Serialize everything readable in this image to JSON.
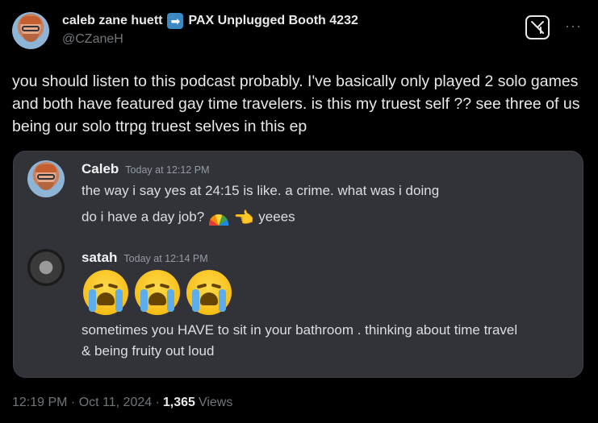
{
  "author": {
    "display_name": "caleb zane huett",
    "arrow_icon": "right-arrow-emoji",
    "status": "PAX Unplugged Booth 4232",
    "handle": "@CZaneH"
  },
  "more_label": "···",
  "tweet": {
    "text": "you should listen to this podcast probably. I've basically only played 2 solo games and both have featured gay time travelers. is this my truest self ?? see three of us being our solo ttrpg truest selves in this ep"
  },
  "embed": {
    "messages": [
      {
        "name": "Caleb",
        "time": "Today at 12:12 PM",
        "lines": [
          "the way i say yes at 24:15 is like. a crime. what was i doing",
          "do i have a day job?",
          "yeees"
        ]
      },
      {
        "name": "satah",
        "time": "Today at 12:14 PM",
        "emojis": [
          "loudly-crying-face",
          "loudly-crying-face",
          "loudly-crying-face"
        ],
        "lines": [
          "sometimes you HAVE to sit in your bathroom . thinking about time travel",
          "& being fruity out loud"
        ]
      }
    ]
  },
  "footer": {
    "timestamp": "12:19 PM · Oct 11, 2024 ·",
    "views_count": "1,365",
    "views_label": "Views"
  },
  "colors": {
    "background": "#000000",
    "card": "#313338",
    "muted": "#71767b"
  }
}
